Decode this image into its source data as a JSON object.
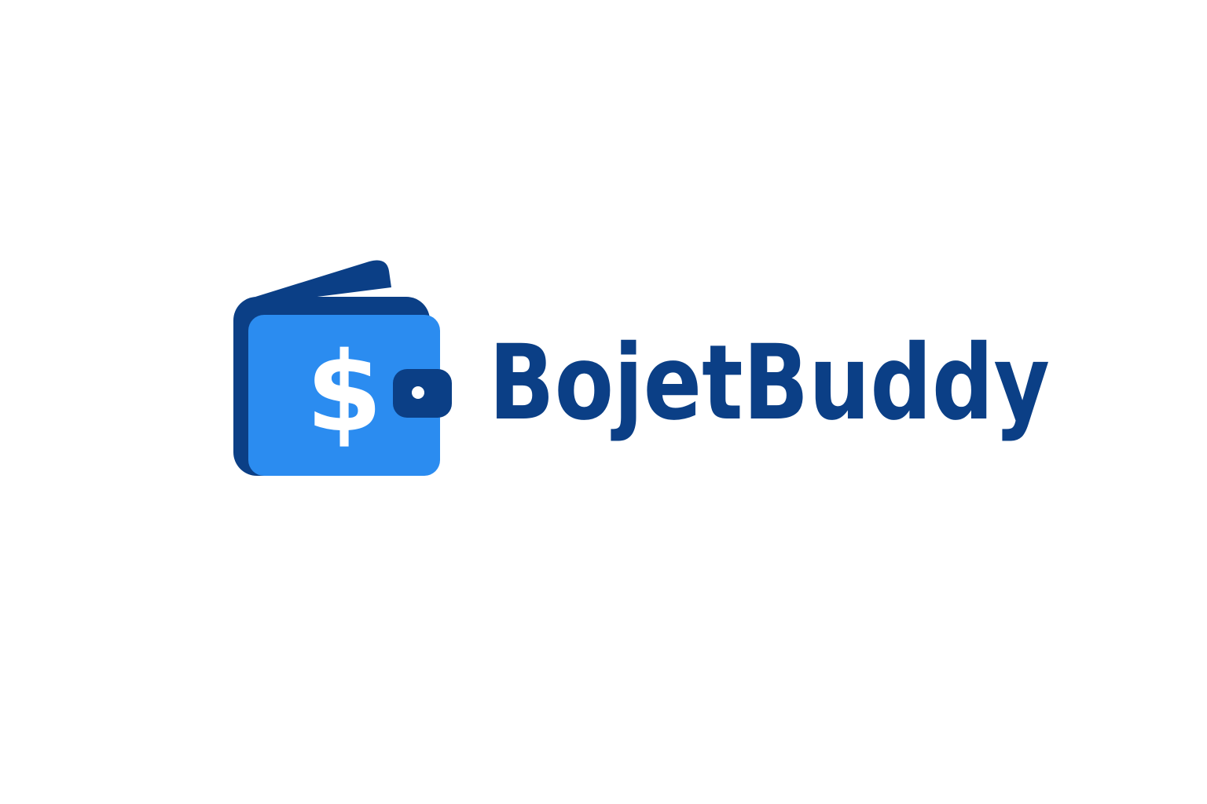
{
  "logo": {
    "wordmark": "BojetBuddy",
    "symbol": "$",
    "icon": "wallet-icon",
    "colors": {
      "dark_blue": "#0b3f86",
      "bright_blue": "#2b8cf0",
      "white": "#ffffff"
    }
  }
}
